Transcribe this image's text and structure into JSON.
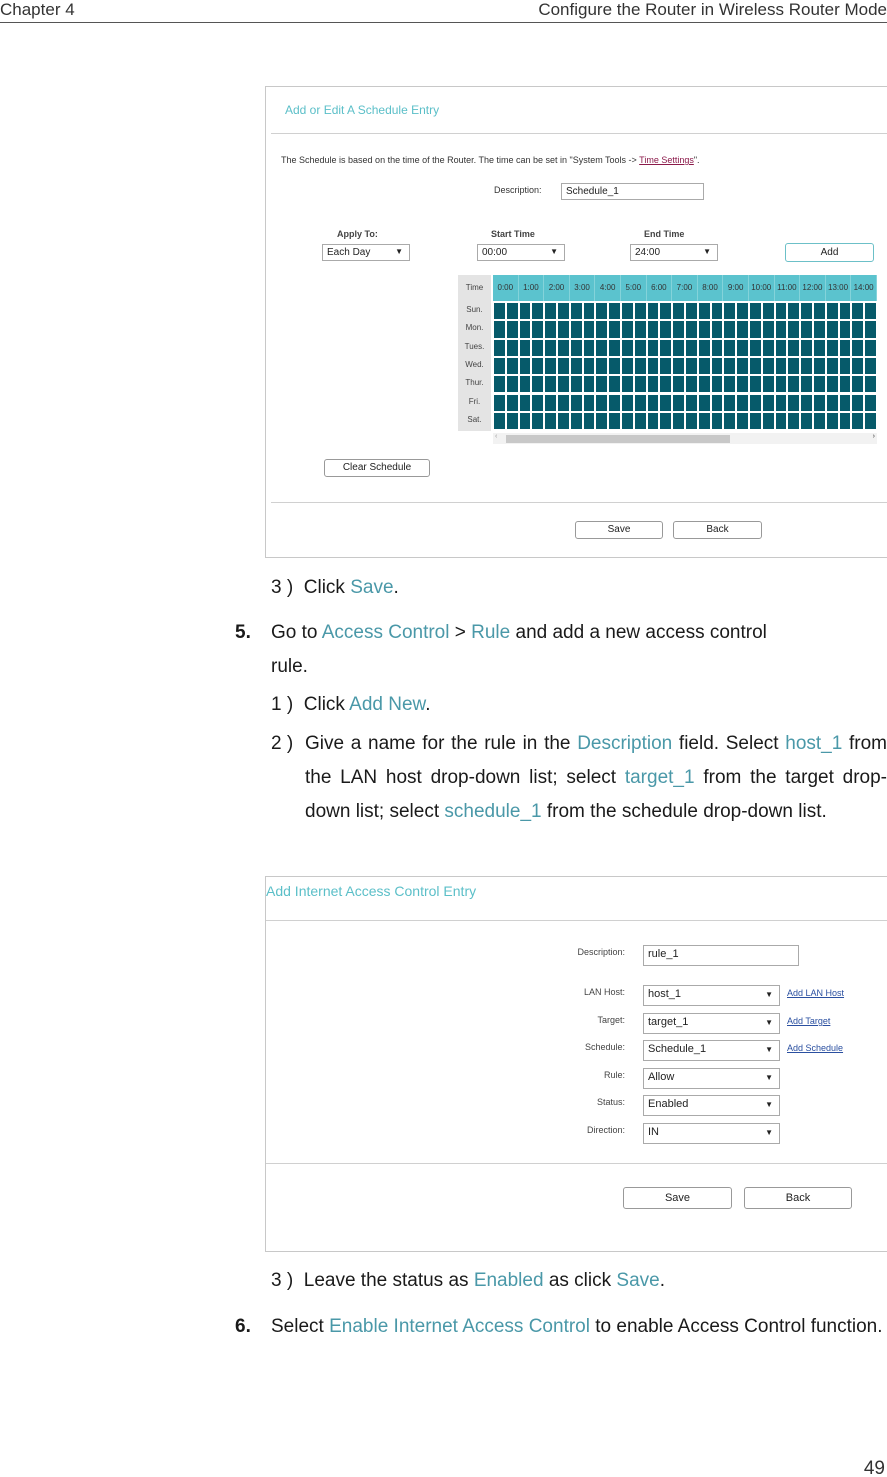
{
  "page_header": {
    "chapter": "Chapter 4",
    "title": "Configure the Router in Wireless Router Mode"
  },
  "schedule_screen": {
    "title": "Add or Edit A Schedule Entry",
    "info_prefix": "The Schedule is based on the time of the Router. The time can be set in \"System Tools -> ",
    "info_link": "Time Settings",
    "info_suffix": "\".",
    "description_label": "Description:",
    "description_value": "Schedule_1",
    "apply_to_label": "Apply To:",
    "apply_to_value": "Each Day",
    "start_time_label": "Start Time",
    "start_time_value": "00:00",
    "end_time_label": "End Time",
    "end_time_value": "24:00",
    "add_button": "Add",
    "grid_corner": "Time",
    "hours": [
      "0:00",
      "1:00",
      "2:00",
      "3:00",
      "4:00",
      "5:00",
      "6:00",
      "7:00",
      "8:00",
      "9:00",
      "10:00",
      "11:00",
      "12:00",
      "13:00",
      "14:00"
    ],
    "days": [
      "Sun.",
      "Mon.",
      "Tues.",
      "Wed.",
      "Thur.",
      "Fri.",
      "Sat."
    ],
    "cell_color_selected": "#065a6a",
    "header_color": "#5bc3ce",
    "scroll_left_icon": "‹",
    "scroll_right_icon": "›",
    "clear_button": "Clear Schedule",
    "save_button": "Save",
    "back_button": "Back"
  },
  "steps_a": {
    "step3": {
      "num": "3 )",
      "text1": "Click ",
      "hl1": "Save",
      "text2": "."
    },
    "step5": {
      "num": "5.",
      "text1": "Go to ",
      "hl1": "Access Control",
      "text2": " > ",
      "hl2": "Rule",
      "text3": " and add a new access control",
      "line2": "rule."
    },
    "sub1": {
      "num": "1 )",
      "text1": "Click ",
      "hl1": "Add New",
      "text2": "."
    },
    "sub2": {
      "num": "2 )",
      "t1": "Give a name for the rule in the ",
      "h1": "Description",
      "t2": " field. Select ",
      "h2": "host_1",
      "t3": " from the LAN host drop-down list; select ",
      "h3": "target_1",
      "t4": " from the target drop-down list; select ",
      "h4": "schedule_1",
      "t5": " from the schedule drop-down list."
    }
  },
  "access_screen": {
    "title": "Add Internet Access Control Entry",
    "fields": [
      {
        "label": "Description:",
        "value": "rule_1",
        "type": "text"
      },
      {
        "label": "LAN Host:",
        "value": "host_1",
        "type": "select",
        "link": "Add LAN Host"
      },
      {
        "label": "Target:",
        "value": "target_1",
        "type": "select",
        "link": "Add Target"
      },
      {
        "label": "Schedule:",
        "value": "Schedule_1",
        "type": "select",
        "link": "Add Schedule"
      },
      {
        "label": "Rule:",
        "value": "Allow",
        "type": "select"
      },
      {
        "label": "Status:",
        "value": "Enabled",
        "type": "select"
      },
      {
        "label": "Direction:",
        "value": "IN",
        "type": "select"
      }
    ],
    "dropdown_icon": "▼",
    "save_button": "Save",
    "back_button": "Back"
  },
  "steps_b": {
    "step3": {
      "num": "3 )",
      "text1": "Leave the status as ",
      "hl1": "Enabled",
      "text2": " as click ",
      "hl2": "Save",
      "text3": "."
    },
    "step6": {
      "num": "6.",
      "text1": "Select ",
      "hl1": "Enable Internet Access Control",
      "text2": " to enable Access Control function."
    }
  },
  "page_number": "49"
}
